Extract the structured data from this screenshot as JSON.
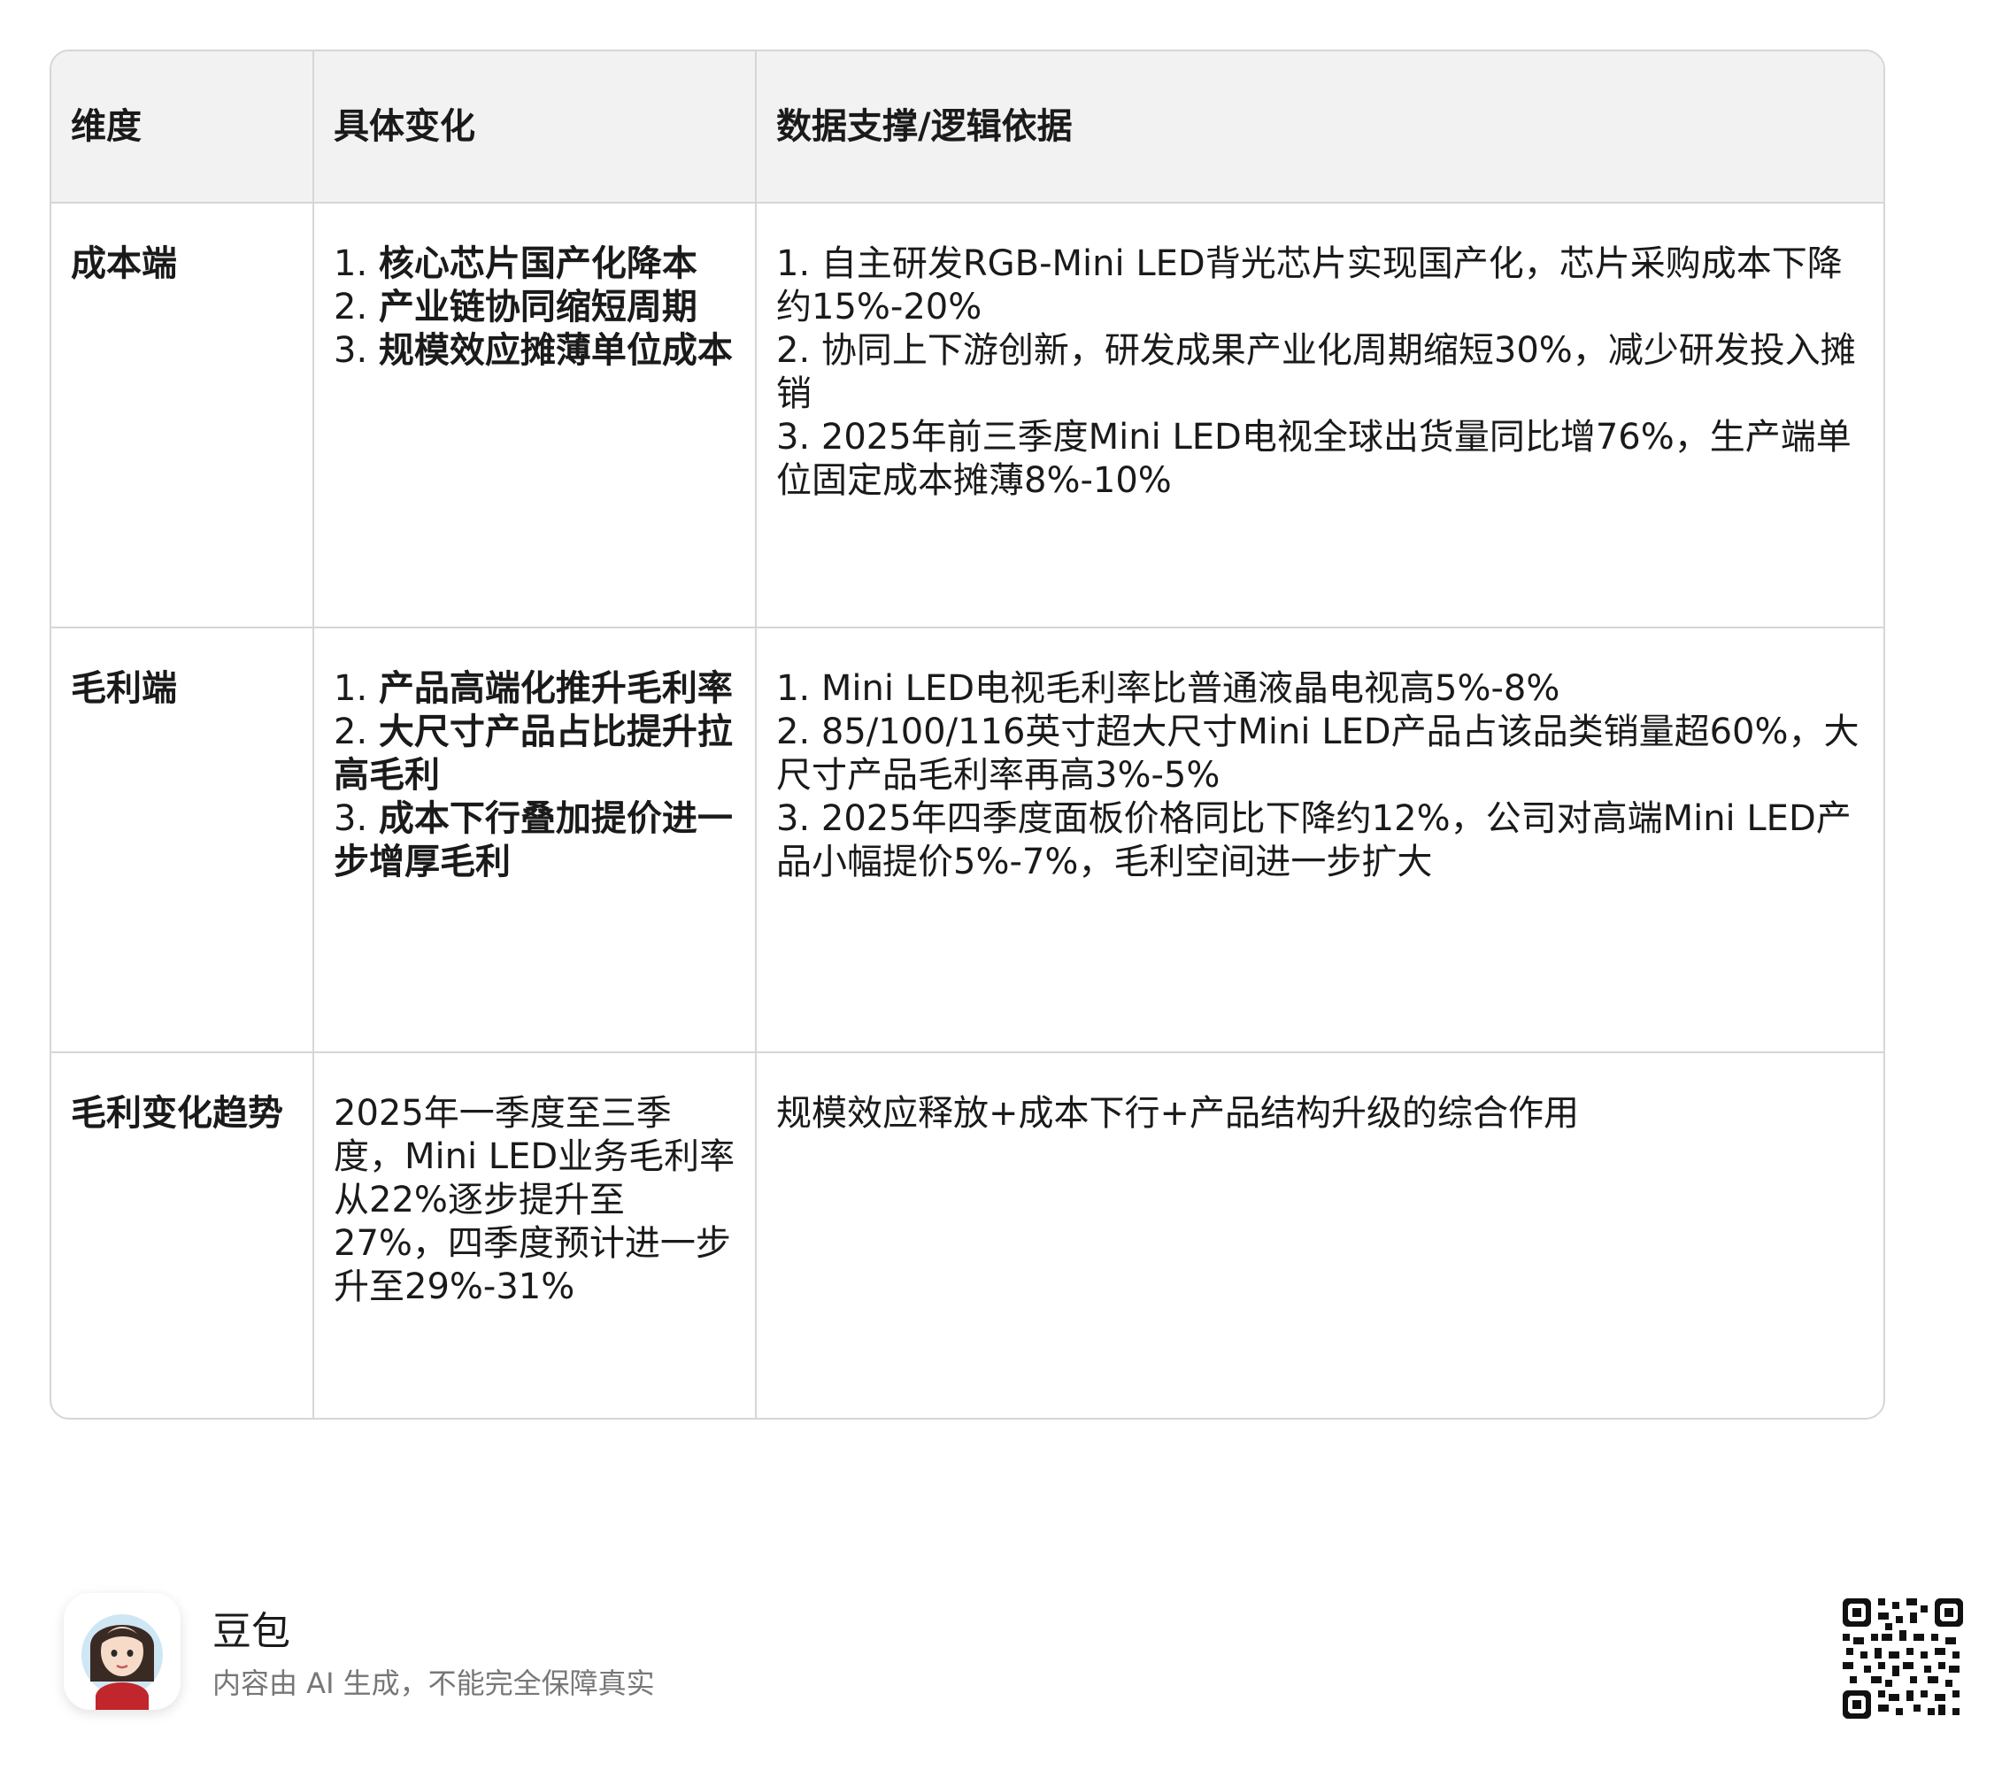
{
  "table": {
    "headers": [
      "维度",
      "具体变化",
      "数据支撑/逻辑依据"
    ],
    "rows": [
      {
        "dimension": "成本端",
        "changes": [
          {
            "num": "1. ",
            "text": "核心芯片国产化降本"
          },
          {
            "num": "2. ",
            "text": "产业链协同缩短周期"
          },
          {
            "num": "3. ",
            "text": "规模效应摊薄单位成本"
          }
        ],
        "evidence": [
          "1. 自主研发RGB-Mini LED背光芯片实现国产化，芯片采购成本下降约15%-20%",
          "2. 协同上下游创新，研发成果产业化周期缩短30%，减少研发投入摊销",
          "3. 2025年前三季度Mini LED电视全球出货量同比增76%，生产端单位固定成本摊薄8%-10%"
        ]
      },
      {
        "dimension": "毛利端",
        "changes": [
          {
            "num": "1. ",
            "text": "产品高端化推升毛利率"
          },
          {
            "num": "2. ",
            "text": "大尺寸产品占比提升拉高毛利"
          },
          {
            "num": "3. ",
            "text": "成本下行叠加提价进一步增厚毛利"
          }
        ],
        "evidence": [
          "1. Mini LED电视毛利率比普通液晶电视高5%-8%",
          "2. 85/100/116英寸超大尺寸Mini LED产品占该品类销量超60%，大尺寸产品毛利率再高3%-5%",
          "3. 2025年四季度面板价格同比下降约12%，公司对高端Mini LED产品小幅提价5%-7%，毛利空间进一步扩大"
        ]
      },
      {
        "dimension": "毛利变化趋势",
        "change_text": "2025年一季度至三季度，Mini LED业务毛利率从22%逐步提升至27%，四季度预计进一步升至29%-31%",
        "evidence_text": "规模效应释放+成本下行+产品结构升级的综合作用"
      }
    ]
  },
  "footer": {
    "app_name": "豆包",
    "disclaimer": "内容由 AI 生成，不能完全保障真实",
    "avatar_icon": "avatar-icon",
    "qr_icon": "qr-code-icon"
  }
}
